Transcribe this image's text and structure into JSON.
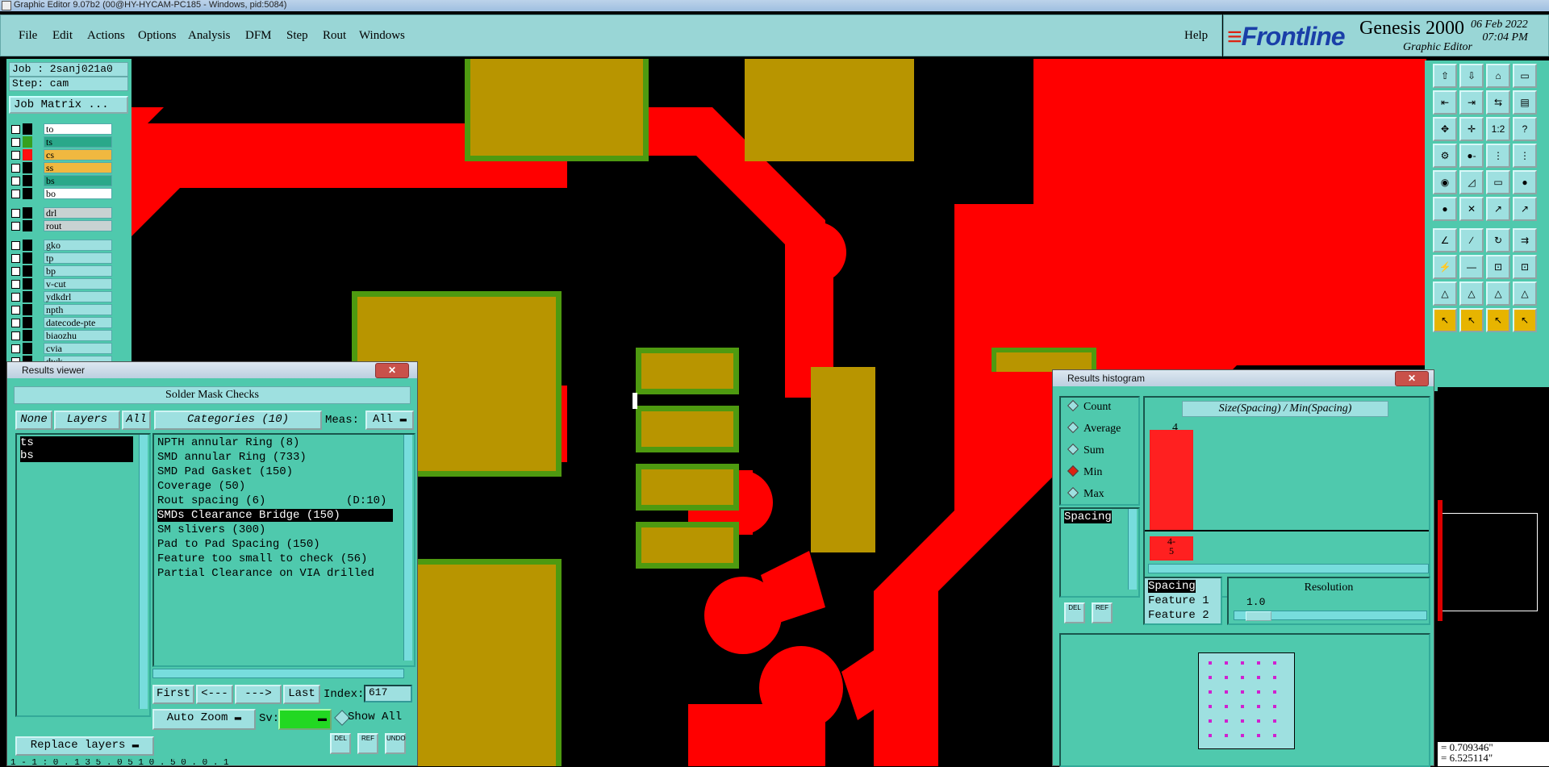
{
  "window_title": "Graphic Editor 9.07b2 (00@HY-HYCAM-PC185 - Windows, pid:5084)",
  "menu": [
    "File",
    "Edit",
    "Actions",
    "Options",
    "Analysis",
    "DFM",
    "Step",
    "Rout",
    "Windows"
  ],
  "help_label": "Help",
  "brand": {
    "logo": "Frontline",
    "product": "Genesis 2000",
    "subtitle": "Graphic Editor",
    "date": "06 Feb 2022",
    "time": "07:04 PM"
  },
  "job": {
    "job": "Job : 2sanj021a0",
    "step": "Step: cam",
    "matrix_button": "Job Matrix ..."
  },
  "layers_top": [
    {
      "name": "to",
      "color": "#000000",
      "bg": "#ffffff"
    },
    {
      "name": "ts",
      "color": "#35a020",
      "bg": "#2aa88a"
    },
    {
      "name": "cs",
      "color": "#ff1010",
      "bg": "#f0b840"
    },
    {
      "name": "ss",
      "color": "#000000",
      "bg": "#f0b840"
    },
    {
      "name": "bs",
      "color": "#000000",
      "bg": "#2aa88a"
    },
    {
      "name": "bo",
      "color": "#000000",
      "bg": "#ffffff"
    }
  ],
  "layers_drill": [
    {
      "name": "drl"
    },
    {
      "name": "rout"
    }
  ],
  "layers_other": [
    {
      "name": "gko"
    },
    {
      "name": "tp"
    },
    {
      "name": "bp"
    },
    {
      "name": "v-cut"
    },
    {
      "name": "ydkdrl"
    },
    {
      "name": "npth"
    },
    {
      "name": "datecode-pte"
    },
    {
      "name": "biaozhu"
    },
    {
      "name": "cvia"
    },
    {
      "name": "dwk"
    }
  ],
  "results_viewer": {
    "title": "Results viewer",
    "header": "Solder Mask Checks",
    "none": "None",
    "layers": "Layers",
    "all": "All",
    "categories_label": "Categories (10)",
    "meas_label": "Meas:",
    "meas_value": "All",
    "layer_items": [
      "ts",
      "bs"
    ],
    "categories": [
      {
        "text": "NPTH annular Ring (8)",
        "extra": ""
      },
      {
        "text": "SMD annular Ring (733)",
        "extra": ""
      },
      {
        "text": "SMD Pad Gasket (150)",
        "extra": ""
      },
      {
        "text": "Coverage (50)",
        "extra": ""
      },
      {
        "text": "Rout spacing (6)",
        "extra": "(D:10)"
      },
      {
        "text": "SMDs Clearance Bridge (150)",
        "extra": ""
      },
      {
        "text": "SM slivers (300)",
        "extra": ""
      },
      {
        "text": "Pad to Pad Spacing (150)",
        "extra": ""
      },
      {
        "text": "Feature too small to check (56)",
        "extra": ""
      },
      {
        "text": "Partial Clearance on VIA drilled",
        "extra": ""
      }
    ],
    "first": "First",
    "prev": "<---",
    "next": "--->",
    "last": "Last",
    "index_label": "Index:",
    "index_value": "617",
    "auto_zoom": "Auto Zoom",
    "sv_label": "Sv:",
    "show_all": "Show All",
    "replace_layers": "Replace layers",
    "mini_buttons": [
      "DEL",
      "REF",
      "UNDO"
    ],
    "status": "1 - 1 : 0 . 1 3 5 . 0 5 1 0 . 5 0 . 0 . 1"
  },
  "histogram": {
    "title": "Results histogram",
    "options": [
      "Count",
      "Average",
      "Sum",
      "Min",
      "Max"
    ],
    "selected": "Min",
    "chart_title": "Size(Spacing) / Min(Spacing)",
    "bar_value": "4",
    "bin_label": "4-\n5",
    "list_item": "Spacing",
    "fields": [
      "Spacing",
      "Feature 1",
      "Feature 2"
    ],
    "resolution_label": "Resolution",
    "resolution_value": "1.0",
    "mini_buttons": [
      "DEL",
      "REF"
    ]
  },
  "coords": {
    "x": "= 0.709346\"",
    "y": "= 6.525114\""
  },
  "colors": {
    "panel": "#4fc9ad",
    "menu": "#99d6d6",
    "copper": "#ff0000",
    "pad": "#b89500",
    "mask": "#4e9a10"
  }
}
